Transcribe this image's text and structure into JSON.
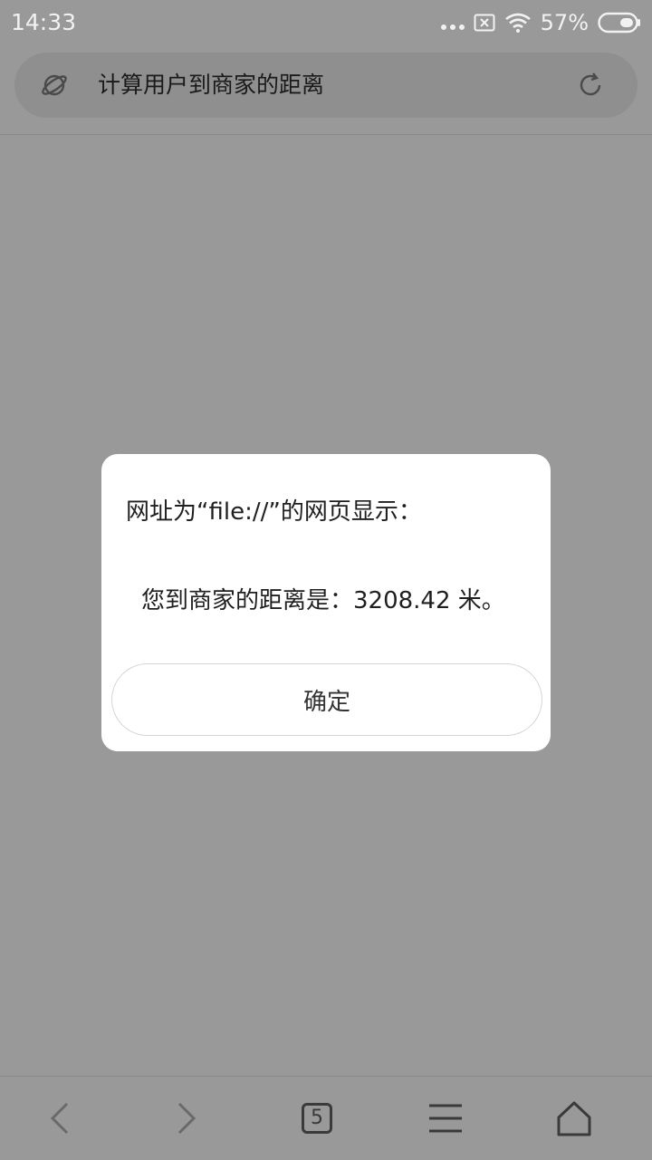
{
  "status_bar": {
    "time": "14:33",
    "battery_percent": "57%",
    "battery_level": 0.57,
    "icons": [
      "more-dots-icon",
      "no-sim-icon",
      "wifi-icon",
      "battery-icon"
    ]
  },
  "address_bar": {
    "page_title": "计算用户到商家的距离",
    "site_icon": "planet-icon",
    "action_icon": "reload-icon"
  },
  "dialog": {
    "title": "网址为“file://”的网页显示：",
    "message": "您到商家的距离是：3208.42 米。",
    "ok_label": "确定"
  },
  "bottom_nav": {
    "back_icon": "chevron-left-icon",
    "forward_icon": "chevron-right-icon",
    "tab_count": "5",
    "menu_icon": "hamburger-menu-icon",
    "home_icon": "home-icon"
  },
  "colors": {
    "overlay_background": "#999999",
    "dialog_background": "#ffffff",
    "text_primary": "#1f1f1f",
    "icon_color": "#3a3a3a"
  }
}
